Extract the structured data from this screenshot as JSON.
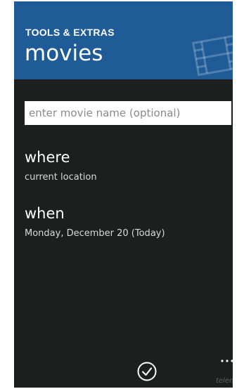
{
  "header": {
    "app_title": "TOOLS & EXTRAS",
    "page_title": "movies",
    "background_color": "#1f5b97",
    "icon": "film-strip-icon"
  },
  "search": {
    "placeholder": "enter movie name (optional)",
    "value": ""
  },
  "where": {
    "label": "where",
    "value": "current location"
  },
  "when": {
    "label": "when",
    "value": "Monday, December 20 (Today)"
  },
  "app_bar": {
    "confirm_icon": "checkmark-circle-icon",
    "more_icon": "ellipsis-icon"
  },
  "branding": {
    "logo_text": "telenav"
  }
}
